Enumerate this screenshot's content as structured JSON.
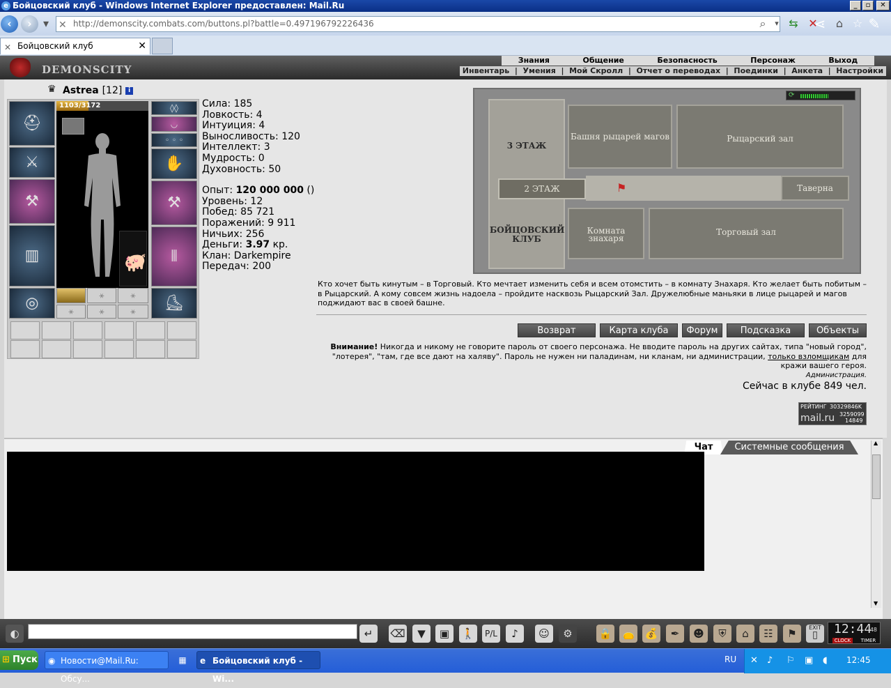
{
  "window": {
    "title": "Бойцовский клуб - Windows Internet Explorer предоставлен: Mail.Ru",
    "min": "_",
    "max": "▫",
    "close": "✕"
  },
  "browser": {
    "url": "http://demonscity.combats.com/buttons.pl?battle=0.497196792226436",
    "tab_title": "Бойцовский клуб"
  },
  "game": {
    "logo": "DEMONSCITY",
    "menu_top": [
      "Знания",
      "Общение",
      "Безопасность",
      "Персонаж",
      "Выход"
    ],
    "menu_bottom": [
      "Инвентарь",
      "|",
      "Умения",
      "|",
      "Мой Скролл",
      "|",
      "Отчет о переводах",
      "|",
      "Поединки",
      "|",
      "Анкета",
      "|",
      "Настройки"
    ]
  },
  "character": {
    "name": "Astrea",
    "level": "[12]",
    "info": "i",
    "hp_text": "1103/3172",
    "hp_fraction": 0.35,
    "stats": [
      {
        "label": "Сила: ",
        "value": "185"
      },
      {
        "label": "Ловкость: ",
        "value": "4"
      },
      {
        "label": "Интуиция: ",
        "value": "4"
      },
      {
        "label": "Выносливость: ",
        "value": "120"
      },
      {
        "label": "Интеллект: ",
        "value": "3"
      },
      {
        "label": "Мудрость: ",
        "value": "0"
      },
      {
        "label": "Духовность: ",
        "value": "50"
      }
    ],
    "exp_label": "Опыт: ",
    "exp_value": "120 000 000",
    "exp_suffix": " ()",
    "level_line": "Уровень: 12",
    "wins": "Побед: 85 721",
    "losses": "Поражений: 9 911",
    "draws": "Ничьих: 256",
    "money_label": "Деньги: ",
    "money_value": "3.97",
    "money_suffix": " кр.",
    "clan": "Клан: Darkempire",
    "transfers": "Передач: 200"
  },
  "map": {
    "floor3": "3 ЭТАЖ",
    "floor2": "2 ЭТАЖ",
    "club": "БОЙЦОВСКИЙ КЛУБ",
    "tower": "Башня рыцарей магов",
    "knights_hall": "Рыцарский зал",
    "tavern": "Таверна",
    "healer_room": "Комната знахаря",
    "trade_hall": "Торговый зал"
  },
  "description": "Кто хочет быть кинутым – в Торговый. Кто мечтает изменить себя и всем отомстить – в комнату Знахаря. Кто желает быть побитым – в Рыцарский. А кому совсем жизнь надоела – пройдите насквозь Рыцарский Зал. Дружелюбные маньяки в лице рыцарей и магов поджидают вас в своей башне.",
  "buttons": [
    "Возврат",
    "Карта клуба",
    "Форум",
    "Подсказка",
    "Объекты"
  ],
  "warning": {
    "bold": "Внимание!",
    "text": " Никогда и никому не говорите пароль от своего персонажа. Не вводите пароль на других сайтах, типа \"новый город\", \"лотерея\", \"там, где все дают на халяву\". Пароль не нужен ни паладинам, ни кланам, ни администрации, ",
    "link": "только взломщикам",
    "end": " для кражи вашего героя."
  },
  "admin": "Администрация.",
  "online": "Сейчас в клубе 849 чел.",
  "counter": {
    "label": "РЕЙТИНГ",
    "brand": "mail.ru",
    "n1": "30329846K",
    "n2": "3259099",
    "n3": "14849"
  },
  "chat": {
    "tab_chat": "Чат",
    "tab_system": "Системные сообщения"
  },
  "clock": {
    "time": "12:44",
    "seconds": "48",
    "exit": "EXIT",
    "clock_label": "CLOCK",
    "timer_label": "TIMER"
  },
  "taskbar": {
    "start": "Пуск",
    "task1": "Новости@Mail.Ru: Обсу...",
    "task2": "Бойцовский клуб - Wi...",
    "lang": "RU",
    "time": "12:45"
  }
}
